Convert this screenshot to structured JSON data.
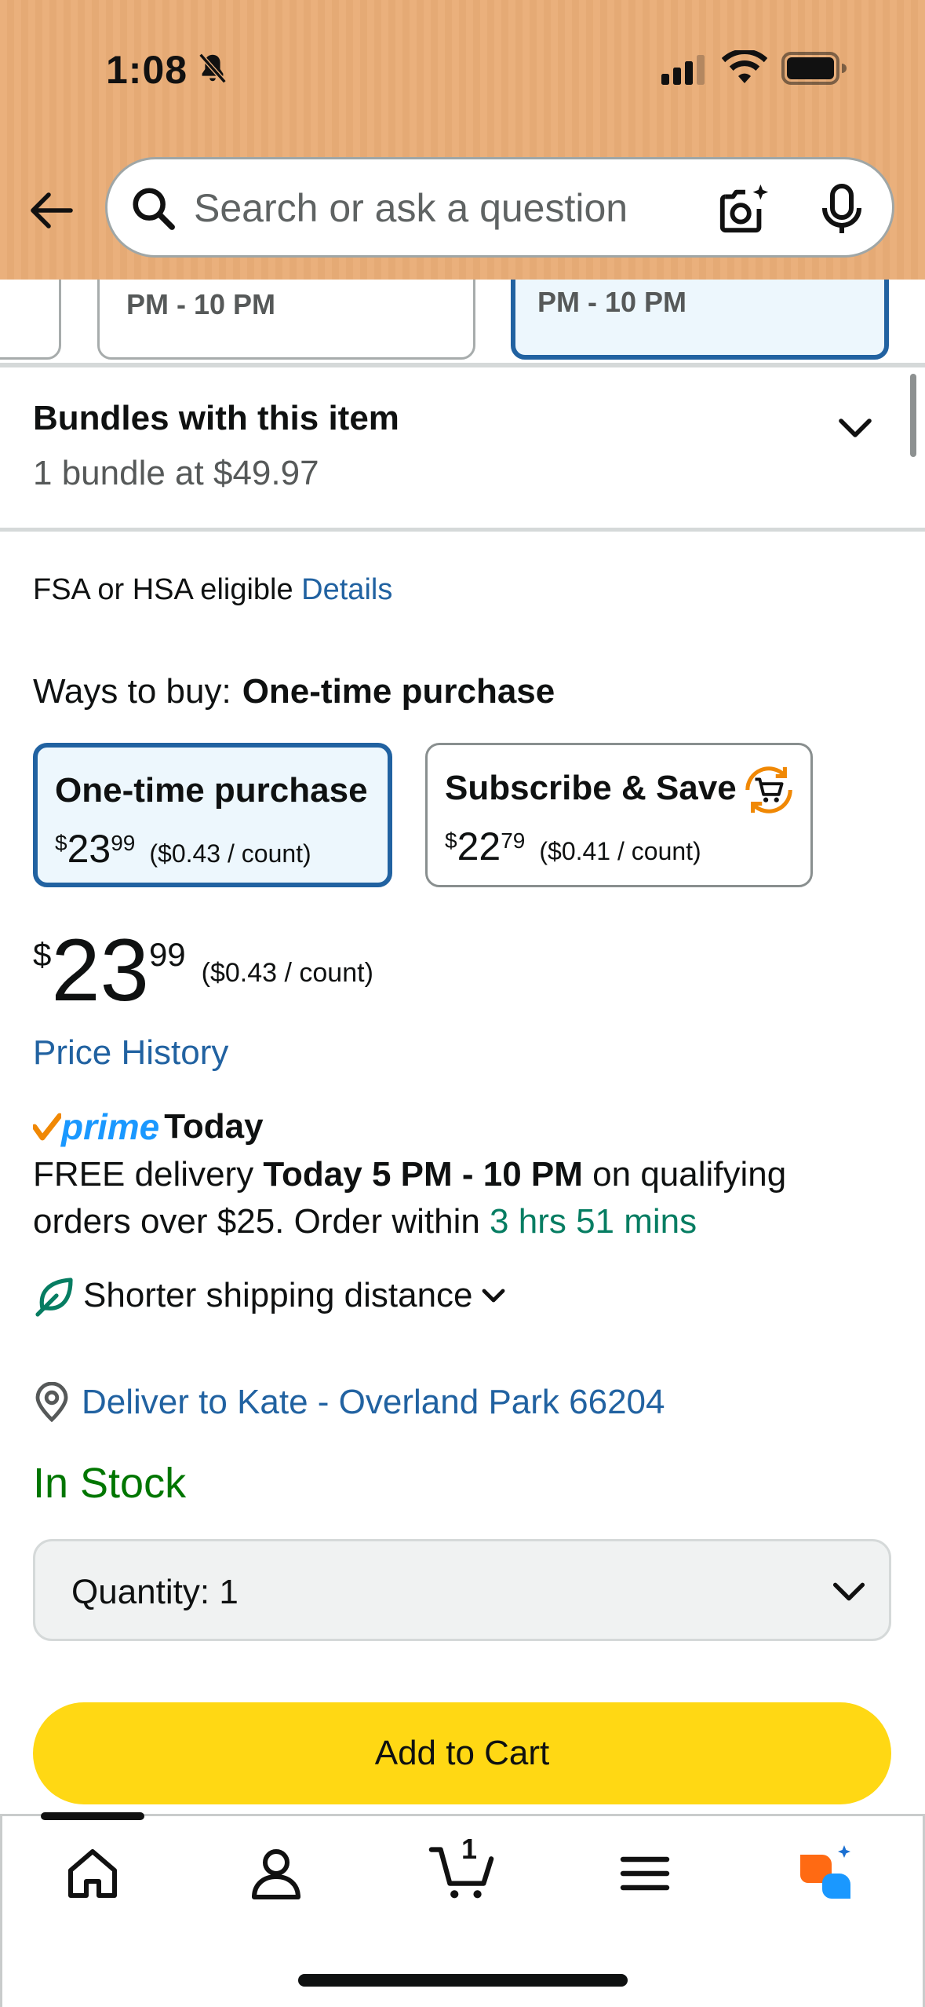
{
  "status": {
    "time": "1:08"
  },
  "search": {
    "placeholder": "Search or ask a question"
  },
  "delivery_slots": [
    {
      "text": ""
    },
    {
      "text": "PM - 10 PM"
    },
    {
      "text": "PM - 10 PM"
    }
  ],
  "bundles": {
    "title": "Bundles with this item",
    "subtitle": "1 bundle at $49.97"
  },
  "fsa": {
    "text": "FSA or HSA eligible",
    "link": "Details"
  },
  "ways_to_buy": {
    "label": "Ways to buy:",
    "selected": "One-time purchase",
    "options": [
      {
        "title": "One-time purchase",
        "currency": "$",
        "whole": "23",
        "cents": "99",
        "unit": "($0.43 / count)"
      },
      {
        "title": "Subscribe & Save",
        "currency": "$",
        "whole": "22",
        "cents": "79",
        "unit": "($0.41 / count)"
      }
    ]
  },
  "price": {
    "currency": "$",
    "whole": "23",
    "cents": "99",
    "unit": "($0.43 / count)"
  },
  "price_history": "Price History",
  "prime": {
    "brand": "prime",
    "today": "Today"
  },
  "delivery": {
    "prefix": "FREE delivery",
    "window": "Today 5 PM - 10 PM",
    "middle": "on qualifying orders over $25. Order within",
    "countdown": "3 hrs 51 mins"
  },
  "shorter_shipping": "Shorter shipping distance",
  "deliver_to": "Deliver to Kate - Overland Park 66204",
  "stock": "In Stock",
  "quantity": {
    "label": "Quantity:",
    "value": "1"
  },
  "add_to_cart": "Add to Cart",
  "tabbar": {
    "cart_count": "1"
  },
  "colors": {
    "header": "#e9ae79",
    "link": "#2162a1",
    "in_stock": "#007600",
    "countdown": "#067d62",
    "add_to_cart": "#ffd814",
    "selected_border": "#2162a1"
  }
}
